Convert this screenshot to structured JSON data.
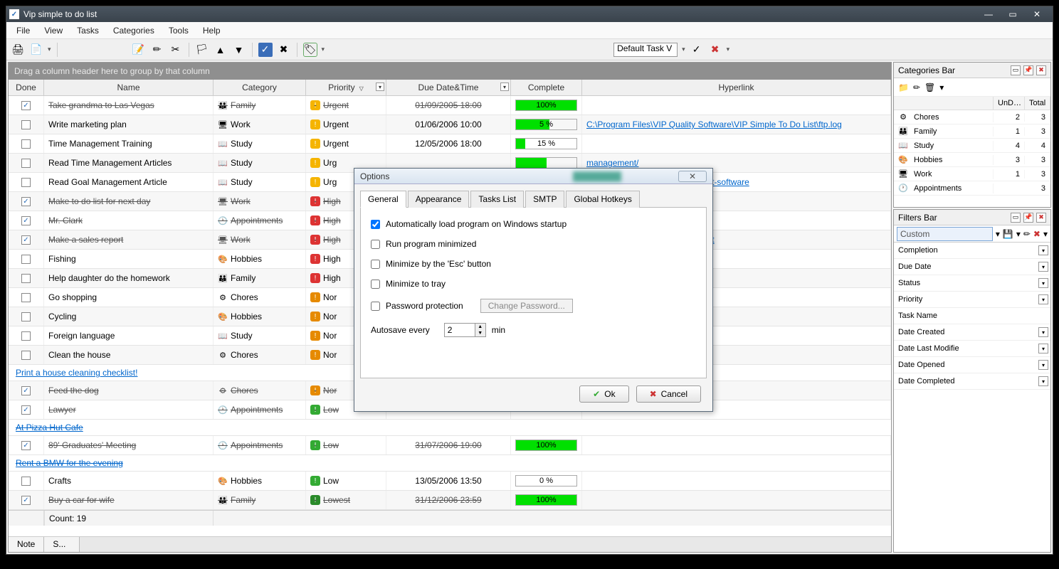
{
  "titlebar": {
    "title": "Vip simple to do list"
  },
  "menu": [
    "File",
    "View",
    "Tasks",
    "Categories",
    "Tools",
    "Help"
  ],
  "toolbar": {
    "filter_name": "Default Task V"
  },
  "groupbar": "Drag a column header here to group by that column",
  "columns": {
    "done": "Done",
    "name": "Name",
    "category": "Category",
    "priority": "Priority",
    "due": "Due Date&Time",
    "complete": "Complete",
    "hyperlink": "Hyperlink"
  },
  "rows": [
    {
      "done": true,
      "name": "Take grandma to Las Vegas",
      "cat": "Family",
      "caticon": "👪",
      "pri": "Urgent",
      "due": "01/09/2005 18:00",
      "pct": 100,
      "pct_text": "100%",
      "link": "",
      "strike": true
    },
    {
      "done": false,
      "name": "Write marketing plan",
      "cat": "Work",
      "caticon": "🖥",
      "pri": "Urgent",
      "due": "01/06/2006 10:00",
      "pct": 55,
      "pct_text": "5 %",
      "link": "C:\\Program Files\\VIP Quality Software\\VIP Simple To Do List\\ftp.log"
    },
    {
      "done": false,
      "name": "Time Management Training",
      "cat": "Study",
      "caticon": "📖",
      "pri": "Urgent",
      "due": "12/05/2006 18:00",
      "pct": 15,
      "pct_text": "15 %",
      "link": ""
    },
    {
      "done": false,
      "name": "Read Time Management Articles",
      "cat": "Study",
      "caticon": "📖",
      "pri": "Urg",
      "due": "",
      "pct": 50,
      "pct_text": "",
      "link": "management/",
      "blurlink": true
    },
    {
      "done": false,
      "name": "Read Goal Management Article",
      "cat": "Study",
      "caticon": "📖",
      "pri": "Urg",
      "due": "",
      "pct": 0,
      "pct_text": "",
      "link": "s/management/goal-management-software"
    },
    {
      "done": true,
      "name": "Make to do list for next day",
      "cat": "Work",
      "caticon": "🖥",
      "pri": "High",
      "due": "",
      "pct": 0,
      "pct_text": "",
      "link": "",
      "strike": true
    },
    {
      "done": true,
      "name": "Mr. Clark",
      "cat": "Appointments",
      "caticon": "🕐",
      "pri": "High",
      "due": "",
      "pct": 0,
      "pct_text": "",
      "link": "",
      "strike": true
    },
    {
      "done": true,
      "name": "Make a sales report",
      "cat": "Work",
      "caticon": "🖥",
      "pri": "High",
      "due": "",
      "pct": 0,
      "pct_text": "",
      "link": "\\VIP Simple To Do List\\License.txt",
      "strike": true
    },
    {
      "done": false,
      "name": "Fishing",
      "cat": "Hobbies",
      "caticon": "🎨",
      "pri": "High",
      "due": "",
      "pct": 0,
      "pct_text": "",
      "link": ""
    },
    {
      "done": false,
      "name": "Help daughter do the homework",
      "cat": "Family",
      "caticon": "👪",
      "pri": "High",
      "due": "",
      "pct": 0,
      "pct_text": "",
      "link": ""
    },
    {
      "done": false,
      "name": "Go shopping",
      "cat": "Chores",
      "caticon": "⚙",
      "pri": "Nor",
      "due": "",
      "pct": 0,
      "pct_text": "",
      "link": ""
    },
    {
      "done": false,
      "name": "Cycling",
      "cat": "Hobbies",
      "caticon": "🎨",
      "pri": "Nor",
      "due": "",
      "pct": 0,
      "pct_text": "",
      "link": ""
    },
    {
      "done": false,
      "name": "Foreign language",
      "cat": "Study",
      "caticon": "📖",
      "pri": "Nor",
      "due": "",
      "pct": 0,
      "pct_text": "",
      "link": ""
    },
    {
      "done": false,
      "name": "Clean the house",
      "cat": "Chores",
      "caticon": "⚙",
      "pri": "Nor",
      "due": "",
      "pct": 0,
      "pct_text": "",
      "link": ""
    },
    {
      "group": "Print a house cleaning checklist!"
    },
    {
      "done": true,
      "name": "Feed the dog",
      "cat": "Chores",
      "caticon": "⚙",
      "pri": "Nor",
      "due": "",
      "pct": 0,
      "pct_text": "",
      "link": "",
      "strike": true
    },
    {
      "done": true,
      "name": "Lawyer",
      "cat": "Appointments",
      "caticon": "🕐",
      "pri": "Low",
      "due": "",
      "pct": 0,
      "pct_text": "",
      "link": "",
      "strike": true
    },
    {
      "group": "At Pizza Hut Cafe",
      "strike": true
    },
    {
      "done": true,
      "name": "89' Graduates' Meeting",
      "cat": "Appointments",
      "caticon": "🕐",
      "pri": "Low",
      "due": "31/07/2006 19:00",
      "pct": 100,
      "pct_text": "100%",
      "link": "",
      "strike": true
    },
    {
      "group": "Rent a BMW for the evening",
      "strike": true
    },
    {
      "done": false,
      "name": "Crafts",
      "cat": "Hobbies",
      "caticon": "🎨",
      "pri": "Low",
      "due": "13/05/2006 13:50",
      "pct": 0,
      "pct_text": "0 %",
      "link": ""
    },
    {
      "done": true,
      "name": "Buy a car for wife",
      "cat": "Family",
      "caticon": "👪",
      "pri": "Lowest",
      "due": "31/12/2006 23:59",
      "pct": 100,
      "pct_text": "100%",
      "link": "",
      "strike": true
    }
  ],
  "footer_count": "Count: 19",
  "bottom_tabs": [
    "Note",
    "S..."
  ],
  "categories_bar": {
    "title": "Categories Bar",
    "head": {
      "name": "",
      "und": "UnD…",
      "total": "Total"
    },
    "rows": [
      {
        "icon": "⚙",
        "name": "Chores",
        "und": "2",
        "total": "3"
      },
      {
        "icon": "👪",
        "name": "Family",
        "und": "1",
        "total": "3"
      },
      {
        "icon": "📖",
        "name": "Study",
        "und": "4",
        "total": "4"
      },
      {
        "icon": "🎨",
        "name": "Hobbies",
        "und": "3",
        "total": "3"
      },
      {
        "icon": "🖥",
        "name": "Work",
        "und": "1",
        "total": "3"
      },
      {
        "icon": "🕐",
        "name": "Appointments",
        "und": "",
        "total": "3"
      }
    ]
  },
  "filters_bar": {
    "title": "Filters Bar",
    "selected": "Custom",
    "fields": [
      "Completion",
      "Due Date",
      "Status",
      "Priority",
      "Task Name",
      "Date Created",
      "Date Last Modifie",
      "Date Opened",
      "Date Completed"
    ]
  },
  "dialog": {
    "title": "Options",
    "tabs": [
      "General",
      "Appearance",
      "Tasks List",
      "SMTP",
      "Global Hotkeys"
    ],
    "opts": {
      "autostart": "Automatically load program on Windows startup",
      "minimized": "Run program minimized",
      "esc": "Minimize by the 'Esc' button",
      "tray": "Minimize to tray",
      "password": "Password protection",
      "change_pw": "Change Password...",
      "autosave_label": "Autosave every",
      "autosave_val": "2",
      "autosave_unit": "min"
    },
    "ok": "Ok",
    "cancel": "Cancel"
  }
}
